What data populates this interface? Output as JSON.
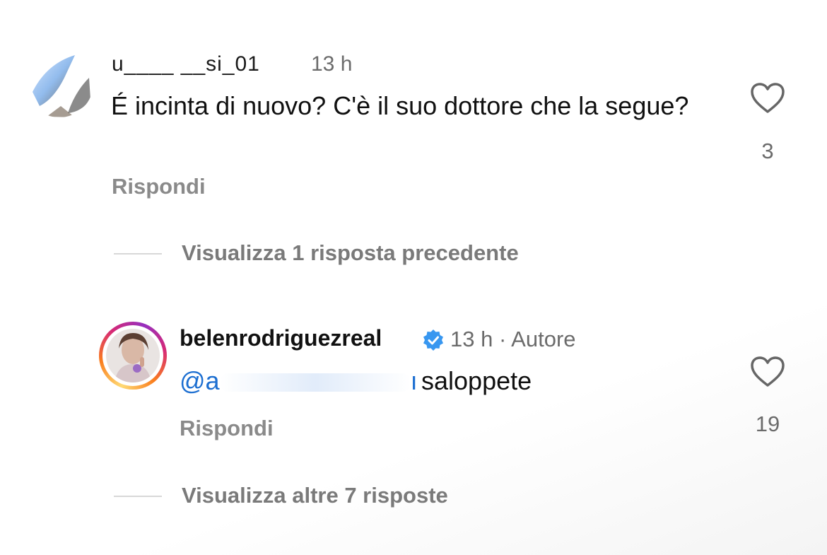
{
  "comment1": {
    "username": "u____  __si_01",
    "time": "13 h",
    "text": "É incinta di nuovo? C'è il suo dottore che la segue?",
    "reply_label": "Rispondi",
    "like_icon": "heart-outline-icon",
    "like_count": "3"
  },
  "view_previous": {
    "label": "Visualizza 1 risposta precedente"
  },
  "comment2": {
    "username": "belenrodriguezreal",
    "verified_icon": "verified-badge-icon",
    "meta": "13 h · Autore",
    "mention_prefix": "@a",
    "mention_suffix": "ı",
    "text": "saloppete",
    "reply_label": "Rispondi",
    "like_icon": "heart-outline-icon",
    "like_count": "19"
  },
  "view_more": {
    "label": "Visualizza altre 7 risposte"
  },
  "colors": {
    "link_blue": "#1d6fd1",
    "verified_blue": "#3897f0",
    "muted_gray": "#8a8a8a",
    "story_ring": "#d62976"
  }
}
